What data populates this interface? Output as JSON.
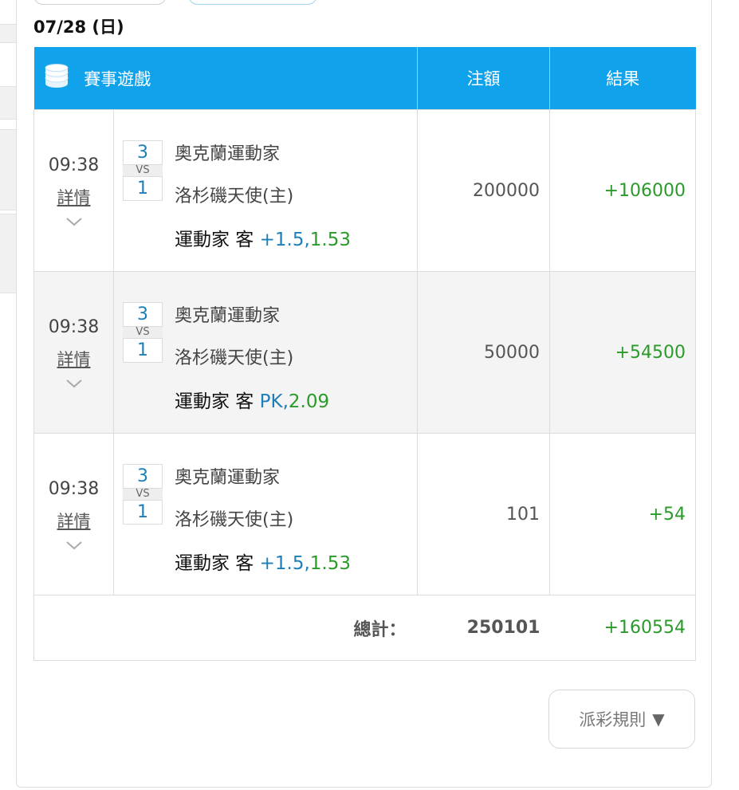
{
  "date": "07/28 (日)",
  "table": {
    "headers": {
      "game": "賽事遊戲",
      "amount": "注額",
      "result": "結果"
    },
    "rows": [
      {
        "time": "09:38",
        "detail": "詳情",
        "score_top": "3",
        "vs": "VS",
        "score_bottom": "1",
        "team1": "奧克蘭運動家",
        "team2": "洛杉磯天使(主)",
        "pick_team": "運動家 客",
        "pick_handicap": "+1.5,",
        "pick_odds": "1.53",
        "amount": "200000",
        "result": "+106000"
      },
      {
        "time": "09:38",
        "detail": "詳情",
        "score_top": "3",
        "vs": "VS",
        "score_bottom": "1",
        "team1": "奧克蘭運動家",
        "team2": "洛杉磯天使(主)",
        "pick_team": "運動家 客",
        "pick_handicap": "PK,",
        "pick_odds": "2.09",
        "amount": "50000",
        "result": "+54500"
      },
      {
        "time": "09:38",
        "detail": "詳情",
        "score_top": "3",
        "vs": "VS",
        "score_bottom": "1",
        "team1": "奧克蘭運動家",
        "team2": "洛杉磯天使(主)",
        "pick_team": "運動家 客",
        "pick_handicap": "+1.5,",
        "pick_odds": "1.53",
        "amount": "101",
        "result": "+54"
      }
    ],
    "total": {
      "label": "總計：",
      "amount": "250101",
      "result": "+160554"
    }
  },
  "rules_button": {
    "label": "派彩規則",
    "arrow": "▼"
  },
  "colors": {
    "header_bg": "#10a3ec",
    "positive": "#2a9a2a",
    "handicap": "#1e7fb8"
  },
  "icons": {
    "header": "coin-stack-icon",
    "expand": "chevron-down-icon"
  }
}
